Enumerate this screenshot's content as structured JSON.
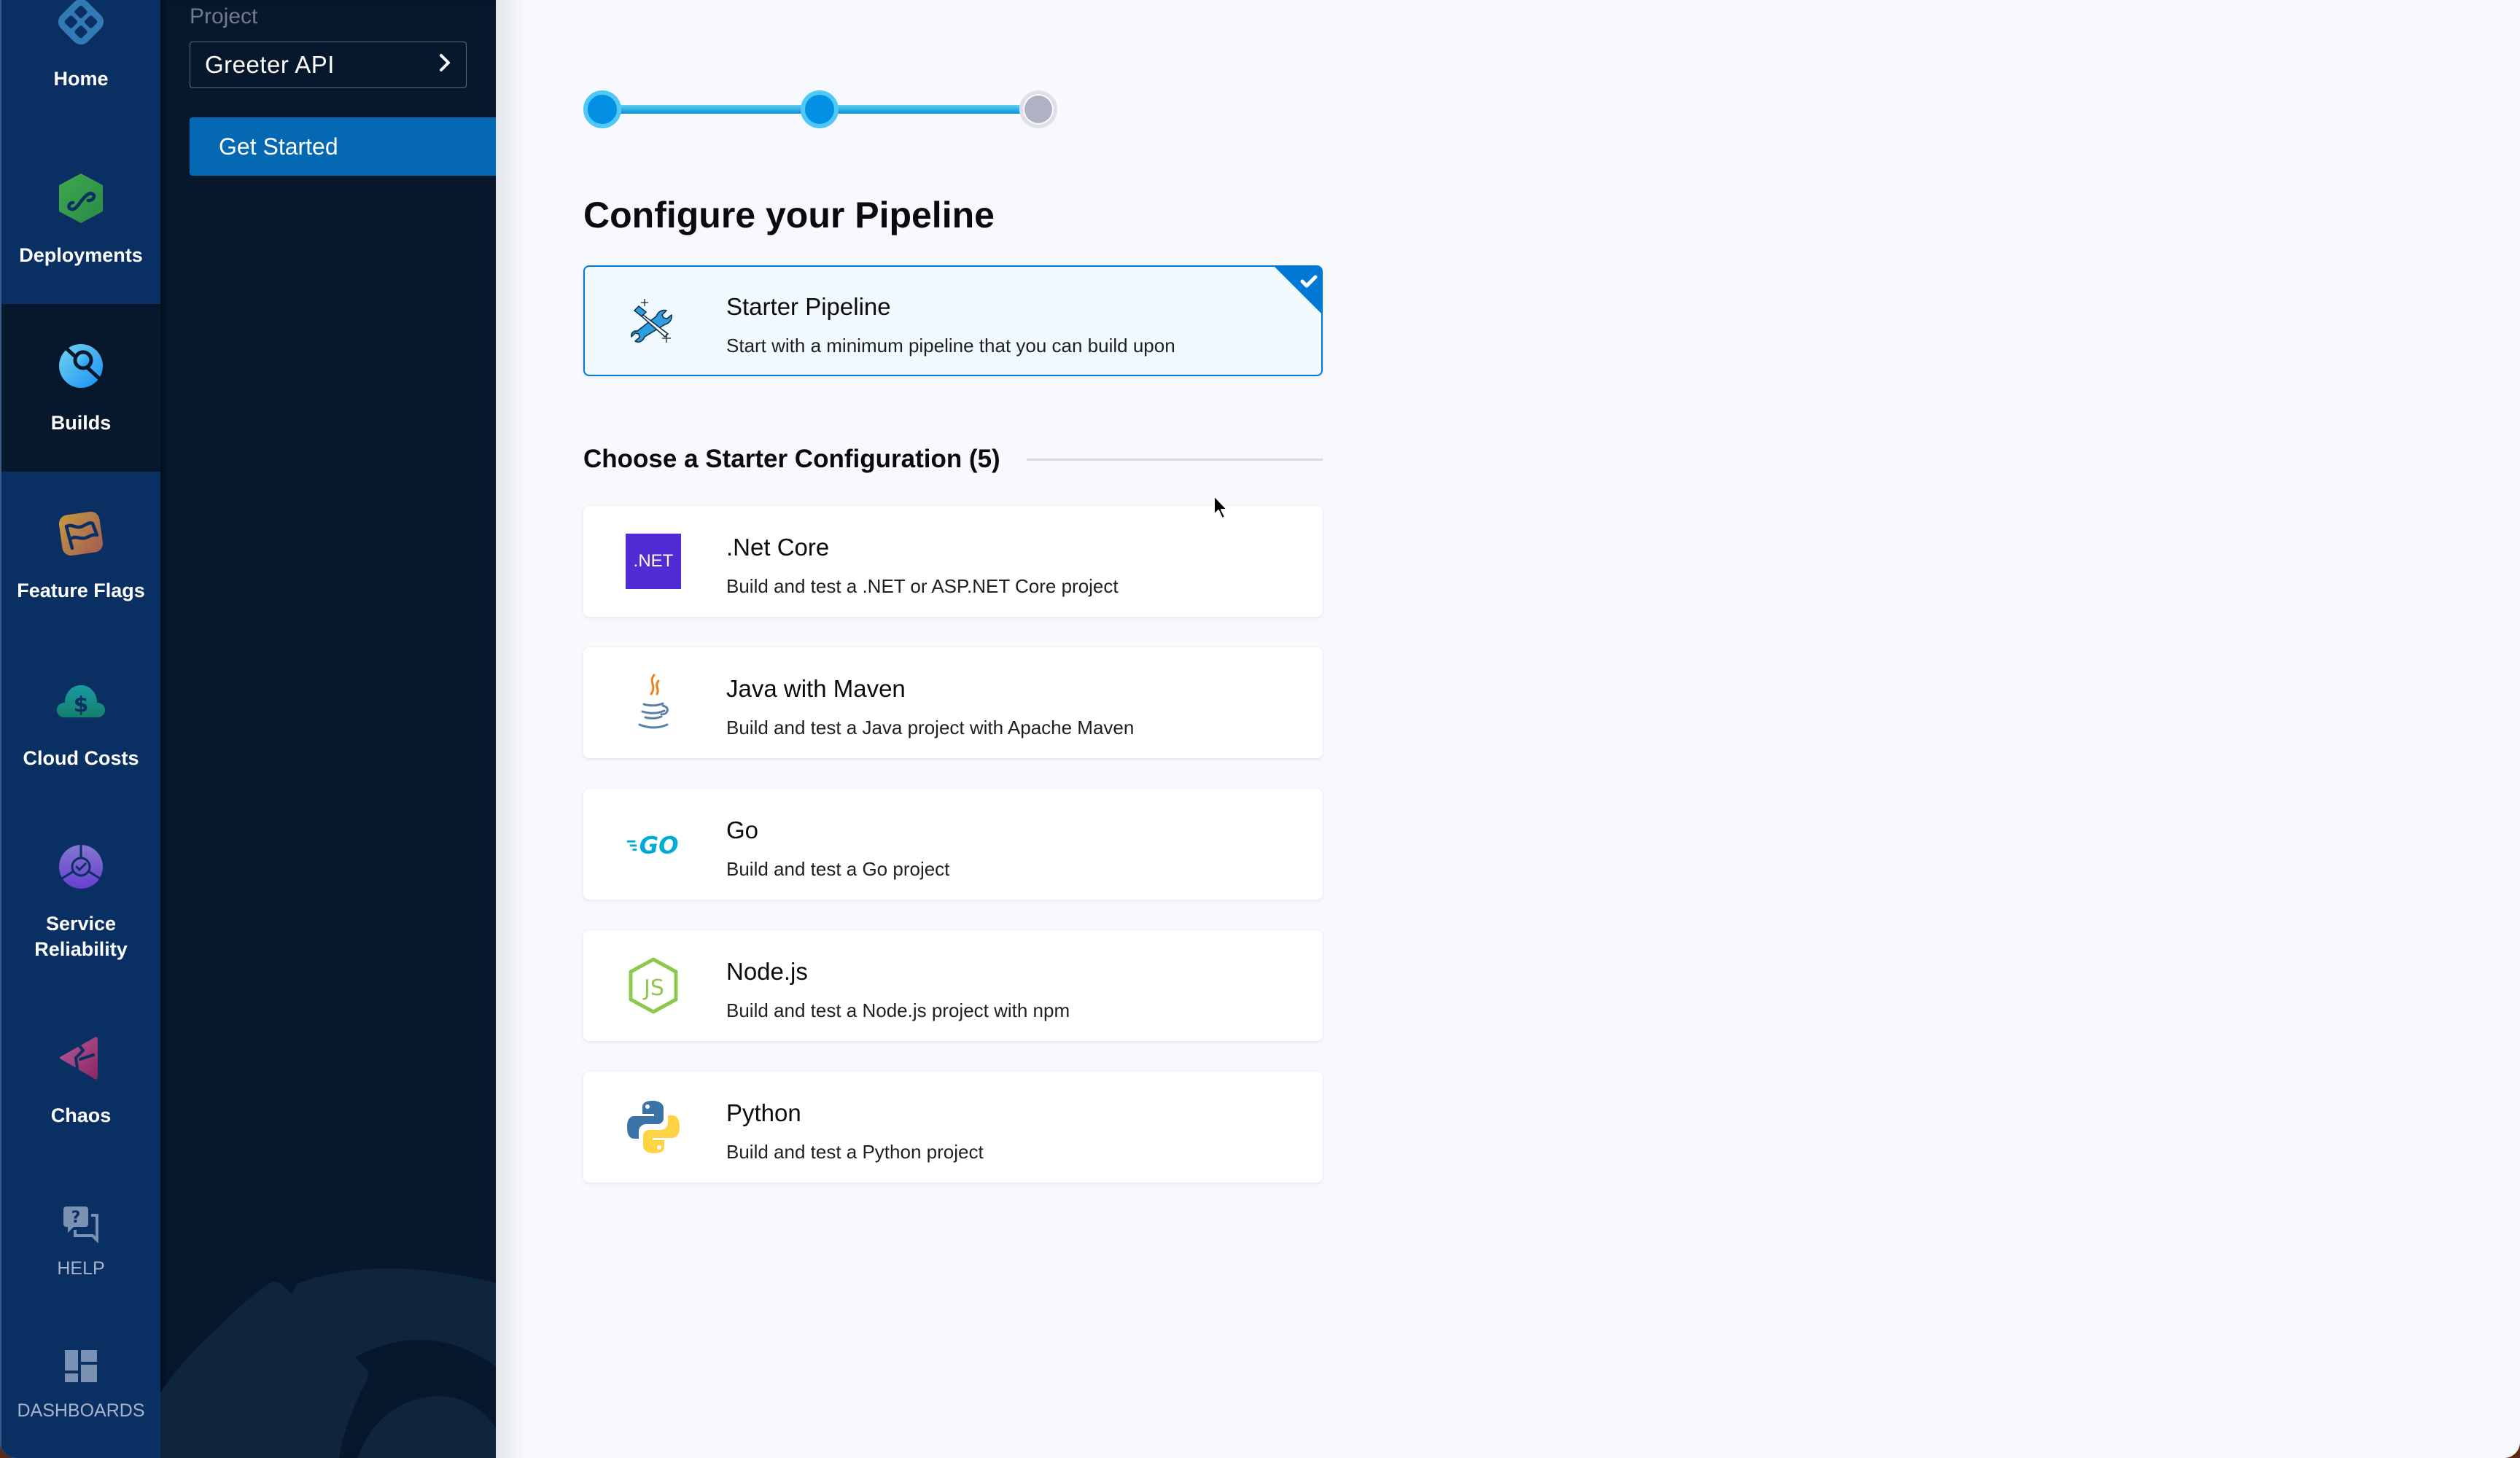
{
  "nav": {
    "items": [
      {
        "label": "Home",
        "icon": "home-icon",
        "active": false
      },
      {
        "label": "Deployments",
        "icon": "deployments-icon",
        "active": false
      },
      {
        "label": "Builds",
        "icon": "builds-icon",
        "active": true
      },
      {
        "label": "Feature Flags",
        "icon": "feature-flags-icon",
        "active": false
      },
      {
        "label": "Cloud Costs",
        "icon": "cloud-costs-icon",
        "active": false
      },
      {
        "label": "Service Reliability",
        "icon": "service-reliability-icon",
        "active": false
      },
      {
        "label": "Chaos",
        "icon": "chaos-icon",
        "active": false
      }
    ],
    "utility": [
      {
        "label": "HELP",
        "icon": "help-icon"
      },
      {
        "label": "DASHBOARDS",
        "icon": "dashboards-icon"
      }
    ]
  },
  "sidebar": {
    "project_label": "Project",
    "project_name": "Greeter API",
    "project_chevron": "chevron-right-icon",
    "menu": [
      {
        "label": "Get Started",
        "active": true
      }
    ]
  },
  "stepper": {
    "total_steps": 3,
    "completed_steps": 2,
    "current_step": 3,
    "colors": {
      "done": "#0290e4",
      "pending": "#b0b1c5"
    }
  },
  "main": {
    "title": "Configure your Pipeline",
    "starter": {
      "title": "Starter Pipeline",
      "description": "Start with a minimum pipeline that you can build upon",
      "icon": "tools-icon",
      "selected": true
    },
    "section_title": "Choose a Starter Configuration (5)",
    "configs": [
      {
        "title": ".Net Core",
        "description": "Build and test a .NET or ASP.NET Core project",
        "icon": "dotnet-icon",
        "icon_text": ".NET"
      },
      {
        "title": "Java with Maven",
        "description": "Build and test a Java project with Apache Maven",
        "icon": "java-icon"
      },
      {
        "title": "Go",
        "description": "Build and test a Go project",
        "icon": "go-icon",
        "icon_text": "GO"
      },
      {
        "title": "Node.js",
        "description": "Build and test a Node.js project with npm",
        "icon": "nodejs-icon",
        "icon_text": "JS"
      },
      {
        "title": "Python",
        "description": "Build and test a Python project",
        "icon": "python-icon"
      }
    ]
  },
  "colors": {
    "nav_bg": "#0a2f62",
    "sidebar_bg": "#07172c",
    "accent": "#0568b3",
    "selected_border": "#0278d5"
  }
}
